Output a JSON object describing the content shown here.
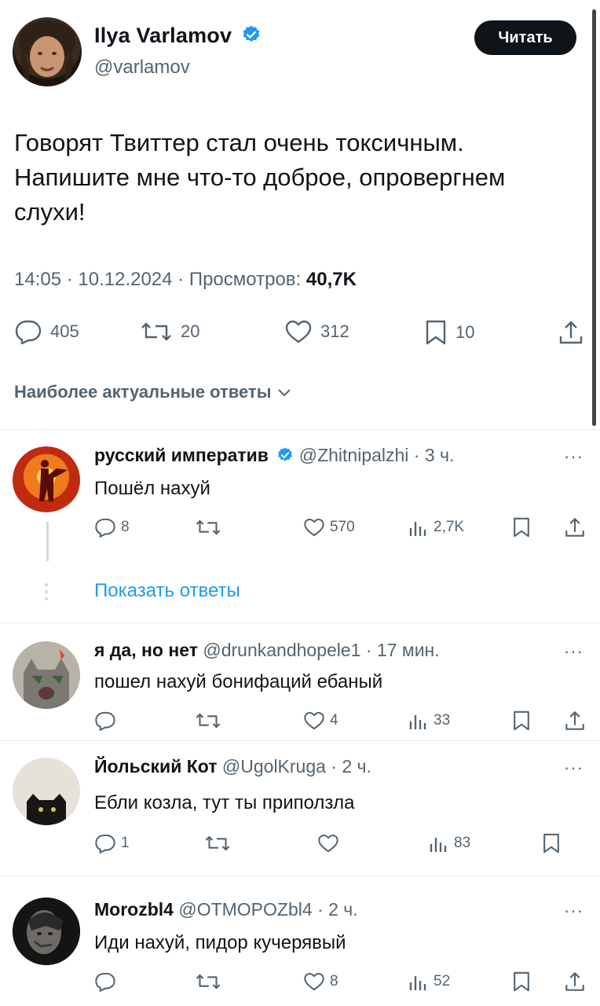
{
  "tweet": {
    "author_name": "Ilya Varlamov",
    "author_handle": "@varlamov",
    "follow_label": "Читать",
    "text": "Говорят Твиттер стал очень токсичным. Напишите мне что-то доброе, опровергнем слухи!",
    "timestamp": "14:05 · 10.12.2024 · Просмотров:",
    "views": "40,7K",
    "replies": "405",
    "retweets": "20",
    "likes": "312",
    "bookmarks": "10"
  },
  "replies_header": "Наиболее актуальные ответы",
  "show_replies_label": "Показать ответы",
  "replies": [
    {
      "name": "русский императив",
      "handle": "@Zhitnipalzhi · 3 ч.",
      "text": "Пошёл нахуй",
      "replies": "8",
      "retweets": "",
      "likes": "570",
      "views": "2,7K"
    },
    {
      "name": "я да, но нет",
      "handle": "@drunkandhopele1 · 17 мин.",
      "text": "пошел нахуй бонифаций ебаный",
      "replies": "",
      "retweets": "",
      "likes": "4",
      "views": "33"
    },
    {
      "name": "Йольский Кот",
      "handle": "@UgolKruga · 2 ч.",
      "text": "Ебли козла, тут ты приползла",
      "replies": "1",
      "retweets": "",
      "likes": "",
      "views": "83"
    },
    {
      "name": "Morozbl4",
      "handle": "@OTMOPOZbl4 · 2 ч.",
      "text": "Иди нахуй, пидор кучерявый",
      "replies": "",
      "retweets": "",
      "likes": "8",
      "views": "52"
    }
  ],
  "colors": {
    "accent": "#1d9bf0",
    "text": "#0f1419",
    "secondary": "#536471",
    "divider": "#e7e9ea"
  }
}
